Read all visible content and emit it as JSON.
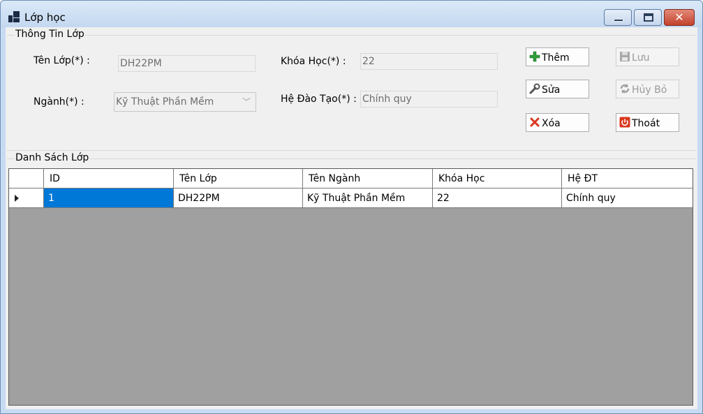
{
  "window": {
    "title": "Lớp học",
    "icons": {
      "app": "app-icon",
      "minimize": "minimize-icon",
      "maximize": "maximize-icon",
      "close": "close-icon"
    },
    "close_glyph": "✕"
  },
  "info_group": {
    "caption": "Thông Tin Lớp",
    "ten_lop_label": "Tên Lớp(*) :",
    "ten_lop_value": "DH22PM",
    "nganh_label": "Ngành(*) :",
    "nganh_value": "Kỹ Thuật Phần Mềm",
    "khoa_hoc_label": "Khóa Học(*) :",
    "khoa_hoc_value": "22",
    "he_dao_tao_label": "Hệ Đào Tạo(*) :",
    "he_dao_tao_value": "Chính quy"
  },
  "buttons": {
    "them": "Thêm",
    "luu": "Lưu",
    "sua": "Sửa",
    "huy_bo": "Hủy Bỏ",
    "xoa": "Xóa",
    "thoat": "Thoát"
  },
  "list_group": {
    "caption": "Danh Sách Lớp",
    "columns": [
      "ID",
      "Tên Lớp",
      "Tên Ngành",
      "Khóa Học",
      "Hệ ĐT"
    ],
    "rows": [
      [
        "1",
        "DH22PM",
        "Kỹ Thuật Phần Mềm",
        "22",
        "Chính quy"
      ]
    ]
  },
  "colors": {
    "selection": "#0078d7",
    "add_icon": "#2e9e3a",
    "delete_icon": "#d9381e",
    "exit_icon": "#d9381e",
    "grid_background": "#a0a0a0"
  }
}
